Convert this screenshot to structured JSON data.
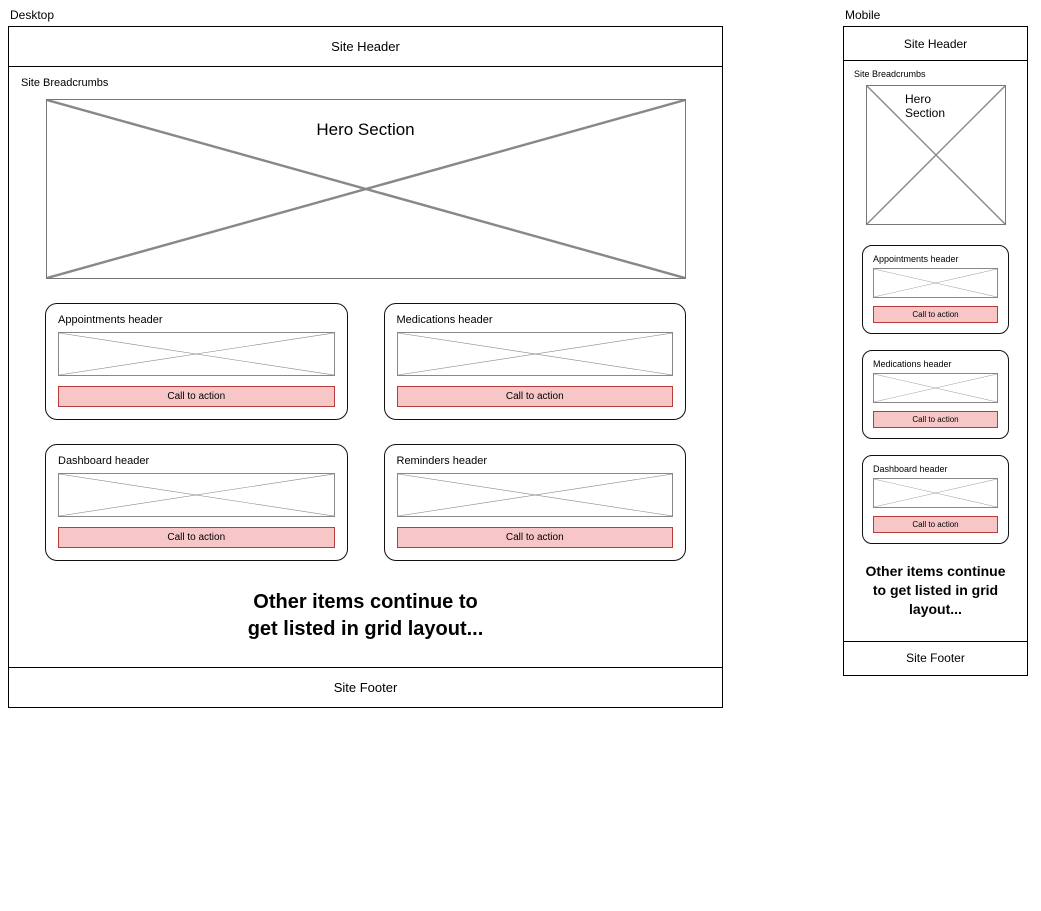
{
  "labels": {
    "desktop_title": "Desktop",
    "mobile_title": "Mobile",
    "site_header": "Site Header",
    "site_footer": "Site Footer",
    "breadcrumbs": "Site Breadcrumbs",
    "hero": "Hero Section",
    "more_items": "Other items continue to get listed in grid layout...",
    "cta": "Call to action"
  },
  "desktop_cards": [
    {
      "header": "Appointments header"
    },
    {
      "header": "Medications header"
    },
    {
      "header": "Dashboard header"
    },
    {
      "header": "Reminders header"
    }
  ],
  "mobile_cards": [
    {
      "header": "Appointments header"
    },
    {
      "header": "Medications header"
    },
    {
      "header": "Dashboard header"
    }
  ],
  "colors": {
    "cta_bg": "#f7c7c7",
    "cta_border": "#b93c3c"
  }
}
